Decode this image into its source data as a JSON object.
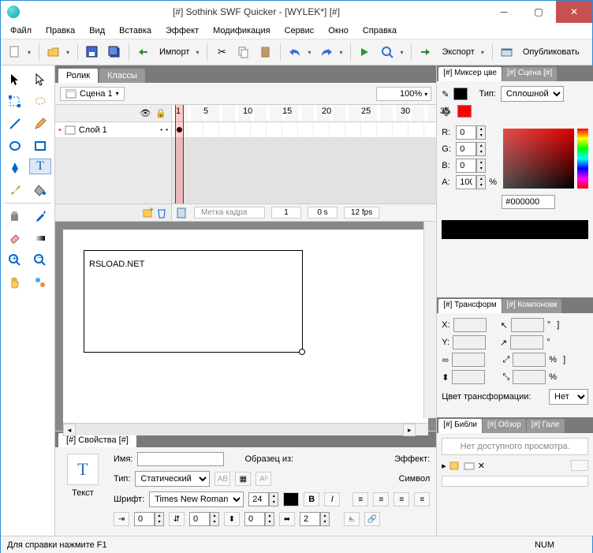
{
  "window": {
    "title": "[#] Sothink SWF Quicker - [WYLEK*] [#]"
  },
  "menu": [
    "Файл",
    "Правка",
    "Вид",
    "Вставка",
    "Эффект",
    "Модификация",
    "Сервис",
    "Окно",
    "Справка"
  ],
  "toolbar": {
    "import": "Импорт",
    "export": "Экспорт",
    "publish": "Опубликовать"
  },
  "centerTabs": {
    "rolik": "Ролик",
    "classes": "Классы"
  },
  "scene": {
    "label": "Сцена 1",
    "zoom": "100%"
  },
  "layer": {
    "name": "Слой 1"
  },
  "timeline": {
    "ticks": [
      "1",
      "5",
      "10",
      "15",
      "20",
      "25",
      "30",
      "35"
    ],
    "frameLabel": "Метка кадра",
    "frame": "1",
    "time": "0 s",
    "fps": "12 fps"
  },
  "canvas": {
    "text": "RSLOAD.NET"
  },
  "props": {
    "tab": "[#] Свойства [#]",
    "leftLabel": "Текст",
    "name": "Имя:",
    "sample": "Образец из:",
    "effect": "Эффект:",
    "type": "Тип:",
    "typeVal": "Статический",
    "symbol": "Символ",
    "font": "Шрифт:",
    "fontVal": "Times New Roman",
    "fontSize": "24",
    "spin1": "0",
    "spin2": "0",
    "spin3": "0",
    "spin4": "2"
  },
  "mixer": {
    "tab1": "[#] Миксер цве",
    "tab2": "[#] Сцена [#]",
    "typeLabel": "Тип:",
    "typeVal": "Сплошной",
    "r": "0",
    "g": "0",
    "b": "0",
    "a": "100",
    "hex": "#000000",
    "pct": "%",
    "rLabel": "R:",
    "gLabel": "G:",
    "bLabel": "B:",
    "aLabel": "A:"
  },
  "transform": {
    "tab1": "[#] Трансформ",
    "tab2": "[#] Компоновк",
    "x": "X:",
    "y": "Y:",
    "pct": "%",
    "colorTrans": "Цвет трансформации:",
    "colorTransVal": "Нет"
  },
  "lib": {
    "tab1": "[#] Библи",
    "tab2": "[#] Обзор",
    "tab3": "[#] Гале",
    "empty": "Нет доступного просмотра."
  },
  "status": {
    "hint": "Для справки нажмите F1",
    "num": "NUM"
  }
}
